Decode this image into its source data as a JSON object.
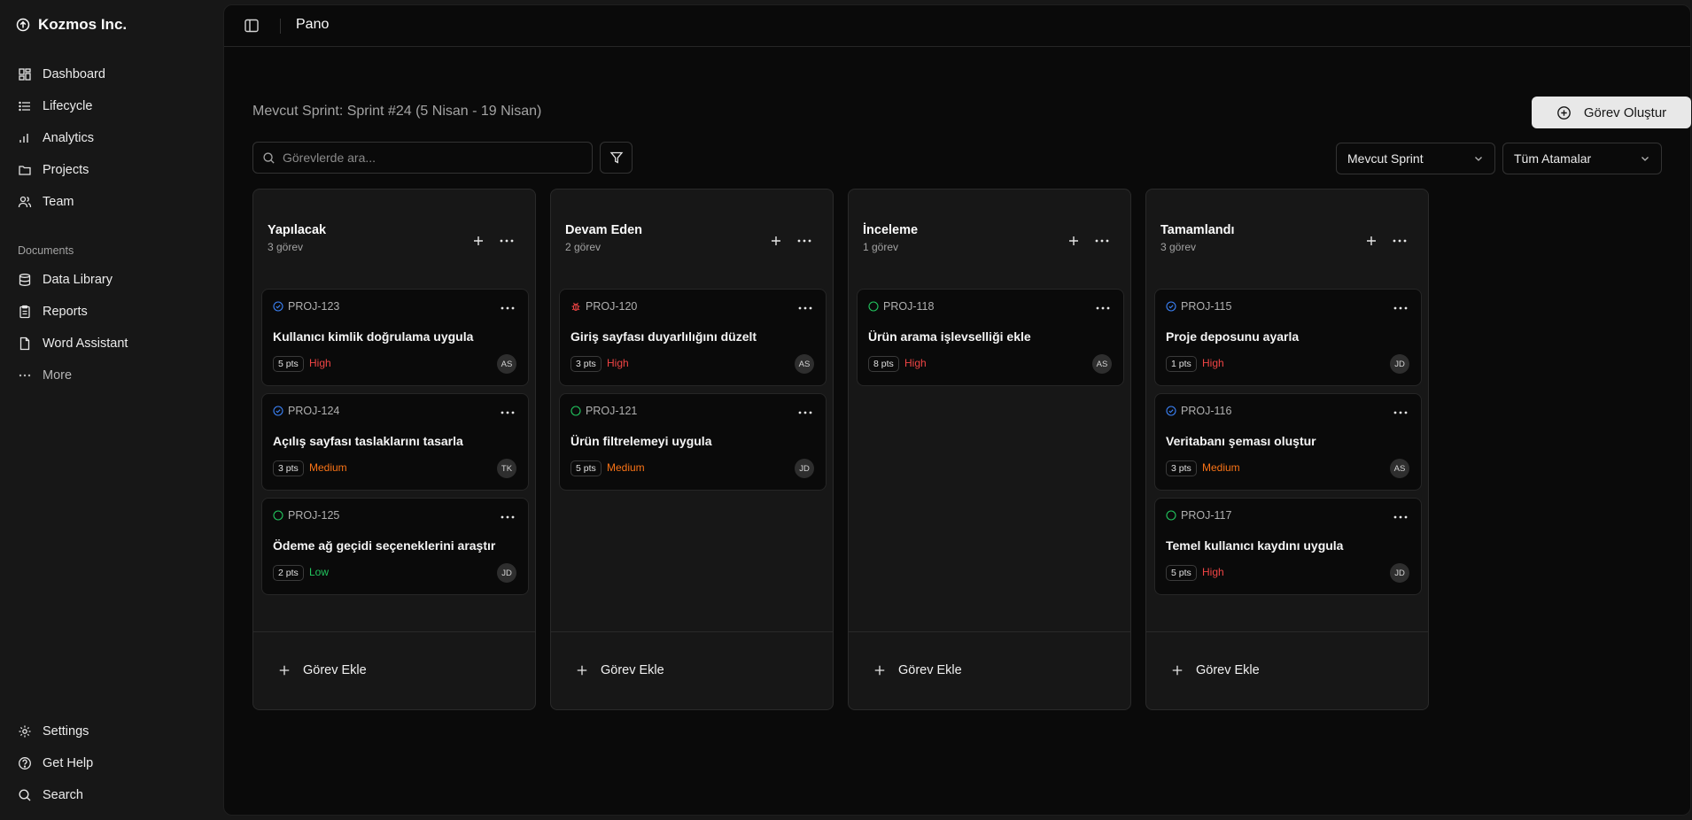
{
  "brand": {
    "name": "Kozmos Inc."
  },
  "nav": {
    "main": [
      {
        "label": "Dashboard",
        "icon": "grid-icon"
      },
      {
        "label": "Lifecycle",
        "icon": "list-icon"
      },
      {
        "label": "Analytics",
        "icon": "chart-icon"
      },
      {
        "label": "Projects",
        "icon": "folder-icon"
      },
      {
        "label": "Team",
        "icon": "users-icon"
      }
    ],
    "section_label": "Documents",
    "documents": [
      {
        "label": "Data Library",
        "icon": "database-icon"
      },
      {
        "label": "Reports",
        "icon": "clipboard-icon"
      },
      {
        "label": "Word Assistant",
        "icon": "file-icon"
      },
      {
        "label": "More",
        "icon": "dots-icon"
      }
    ],
    "bottom": [
      {
        "label": "Settings",
        "icon": "gear-icon"
      },
      {
        "label": "Get Help",
        "icon": "help-icon"
      },
      {
        "label": "Search",
        "icon": "search-icon"
      }
    ]
  },
  "header": {
    "title": "Pano"
  },
  "sprint": {
    "title": "Mevcut Sprint: Sprint #24 (5 Nisan - 19 Nisan)"
  },
  "toolbar": {
    "create_label": "Görev Oluştur",
    "search_placeholder": "Görevlerde ara...",
    "sprint_select": "Mevcut Sprint",
    "assignee_select": "Tüm Atamalar"
  },
  "colors": {
    "high": "#ef4444",
    "medium": "#f97316",
    "low": "#22c55e",
    "blue_icon": "#3b82f6"
  },
  "add_task_label": "Görev Ekle",
  "columns": [
    {
      "title": "Yapılacak",
      "count": "3 görev",
      "cards": [
        {
          "id": "PROJ-123",
          "status_icon": "check-circle-icon",
          "title": "Kullanıcı kimlik doğrulama uygula",
          "pts": "5 pts",
          "priority": "High",
          "assignee": "AS"
        },
        {
          "id": "PROJ-124",
          "status_icon": "check-circle-icon",
          "title": "Açılış sayfası taslaklarını tasarla",
          "pts": "3 pts",
          "priority": "Medium",
          "assignee": "TK"
        },
        {
          "id": "PROJ-125",
          "status_icon": "circle-icon",
          "title": "Ödeme ağ geçidi seçeneklerini araştır",
          "pts": "2 pts",
          "priority": "Low",
          "assignee": "JD"
        }
      ]
    },
    {
      "title": "Devam Eden",
      "count": "2 görev",
      "cards": [
        {
          "id": "PROJ-120",
          "status_icon": "bug-icon",
          "title": "Giriş sayfası duyarlılığını düzelt",
          "pts": "3 pts",
          "priority": "High",
          "assignee": "AS"
        },
        {
          "id": "PROJ-121",
          "status_icon": "circle-icon",
          "title": "Ürün filtrelemeyi uygula",
          "pts": "5 pts",
          "priority": "Medium",
          "assignee": "JD"
        }
      ]
    },
    {
      "title": "İnceleme",
      "count": "1 görev",
      "cards": [
        {
          "id": "PROJ-118",
          "status_icon": "circle-icon",
          "title": "Ürün arama işlevselliği ekle",
          "pts": "8 pts",
          "priority": "High",
          "assignee": "AS"
        }
      ]
    },
    {
      "title": "Tamamlandı",
      "count": "3 görev",
      "cards": [
        {
          "id": "PROJ-115",
          "status_icon": "check-circle-icon",
          "title": "Proje deposunu ayarla",
          "pts": "1 pts",
          "priority": "High",
          "assignee": "JD"
        },
        {
          "id": "PROJ-116",
          "status_icon": "check-circle-icon",
          "title": "Veritabanı şeması oluştur",
          "pts": "3 pts",
          "priority": "Medium",
          "assignee": "AS"
        },
        {
          "id": "PROJ-117",
          "status_icon": "circle-icon",
          "title": "Temel kullanıcı kaydını uygula",
          "pts": "5 pts",
          "priority": "High",
          "assignee": "JD"
        }
      ]
    }
  ]
}
